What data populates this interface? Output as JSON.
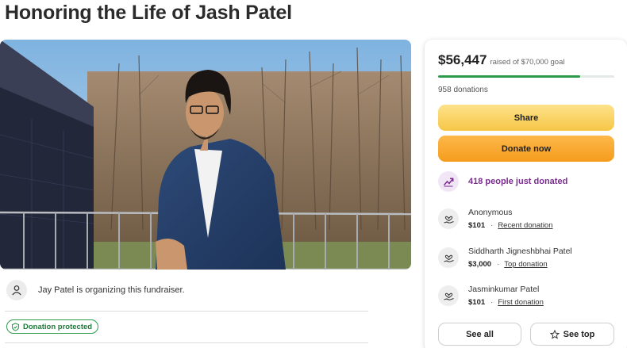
{
  "page": {
    "title": "Honoring the Life of Jash Patel"
  },
  "organizer": {
    "text": "Jay Patel is organizing this fundraiser."
  },
  "badge": {
    "label": "Donation protected"
  },
  "campaign": {
    "raised_amount": "$56,447",
    "goal_text": "raised of $70,000 goal",
    "progress_fraction": 0.806,
    "donation_count": "958 donations",
    "share_label": "Share",
    "donate_label": "Donate now",
    "trend_text": "418 people just donated"
  },
  "donors": [
    {
      "name": "Anonymous",
      "amount": "$101",
      "tag": "Recent donation"
    },
    {
      "name": "Siddharth Jigneshbhai Patel",
      "amount": "$3,000",
      "tag": "Top donation"
    },
    {
      "name": "Jasminkumar Patel",
      "amount": "$101",
      "tag": "First donation"
    }
  ],
  "actions": {
    "see_all_label": "See all",
    "see_top_label": "See top"
  },
  "icons": {
    "organizer": "person-icon",
    "badge": "shield-check-icon",
    "trend": "trending-up-icon",
    "donor": "heart-hand-icon",
    "see_top": "star-icon"
  },
  "colors": {
    "progress": "#2d9a4a",
    "share_button": "#f6c647",
    "donate_button": "#f59c1e",
    "trend_text": "#7b2c91",
    "badge": "#1f7a3a"
  }
}
